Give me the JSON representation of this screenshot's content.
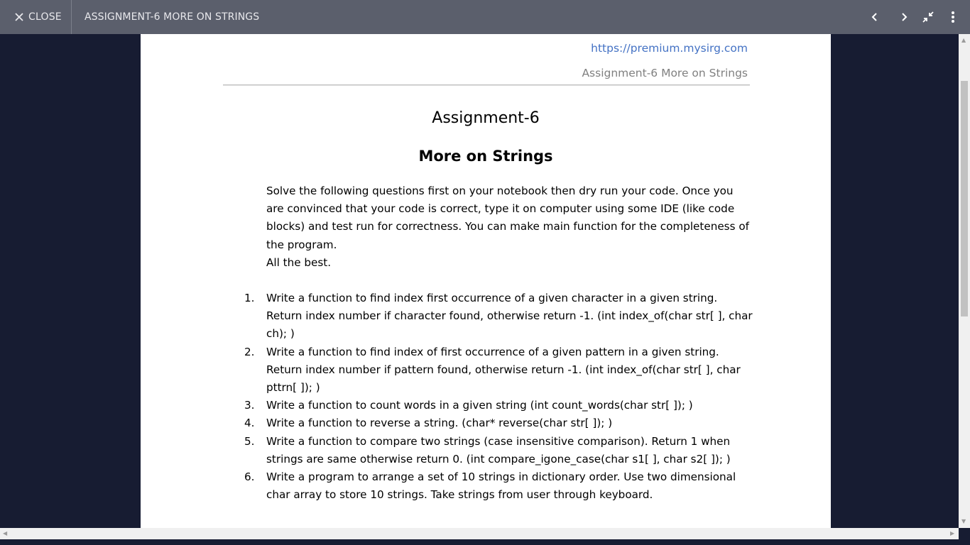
{
  "toolbar": {
    "close_label": "CLOSE",
    "document_title": "ASSIGNMENT-6 MORE ON STRINGS",
    "icons": [
      "close-icon",
      "chevron-left-icon",
      "chevron-right-icon",
      "exit-fullscreen-icon",
      "more-vert-icon"
    ]
  },
  "document": {
    "header_link": "https://premium.mysirg.com",
    "header_subtitle": "Assignment-6 More on Strings",
    "title": "Assignment-6",
    "subtitle": "More on Strings",
    "intro": [
      "Solve the following questions first on your notebook then dry run your code. Once you are convinced that your code is correct, type it on computer using some IDE (like code blocks) and test run for correctness. You can make main function for the completeness of the program.",
      "All the best."
    ],
    "questions": [
      {
        "num": "1.",
        "text": "Write a function to find index first occurrence of a given character in a given string. Return index number if character found, otherwise return -1. (int index_of(char str[ ], char ch); )"
      },
      {
        "num": "2.",
        "text": "Write a function to find index of first occurrence of a given pattern in a given string. Return index number if pattern found, otherwise return -1. (int index_of(char str[ ], char pttrn[ ]); )"
      },
      {
        "num": "3.",
        "text": "Write a function to count words in a given string (int count_words(char str[ ]); )"
      },
      {
        "num": "4.",
        "text": "Write a function to reverse a string. (char* reverse(char str[ ]); )"
      },
      {
        "num": "5.",
        "text": "Write a function to compare two strings (case insensitive comparison). Return 1 when strings are same otherwise return 0. (int compare_igone_case(char s1[ ], char s2[ ]); )"
      },
      {
        "num": "6.",
        "text": "Write a program to arrange a set of 10 strings in dictionary order. Use two dimensional char array to store 10 strings. Take strings from user through keyboard."
      }
    ]
  },
  "colors": {
    "toolbar_bg": "#5b5f6c",
    "backdrop": "#171c32",
    "link": "#4472c4",
    "header_subtitle": "#808080"
  }
}
